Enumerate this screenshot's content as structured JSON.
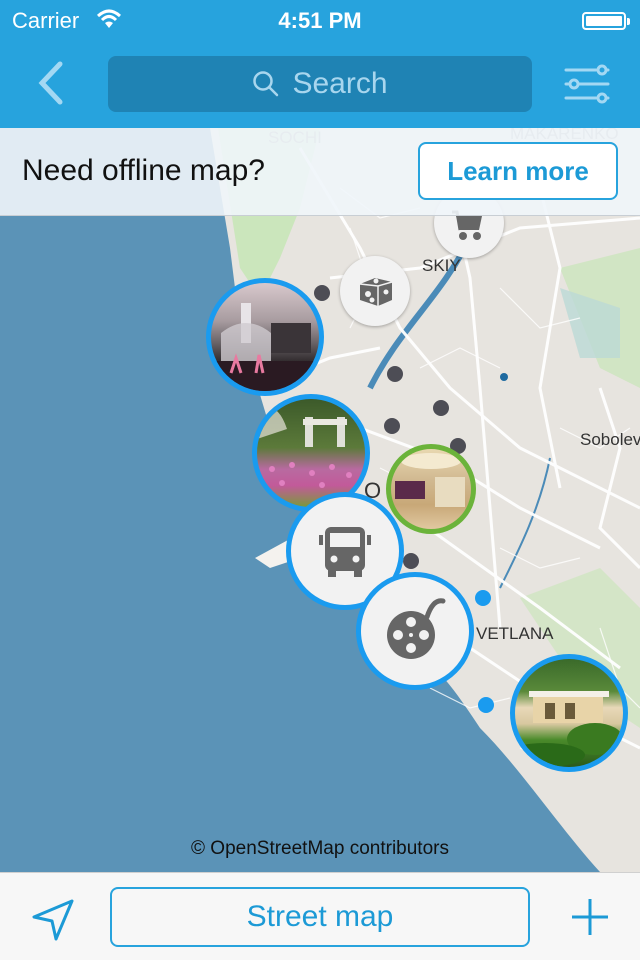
{
  "status_bar": {
    "carrier": "Carrier",
    "time": "4:51 PM",
    "wifi_icon": "wifi-icon",
    "battery_icon": "battery-icon"
  },
  "nav_bar": {
    "back_icon": "chevron-left-icon",
    "search_placeholder": "Search",
    "search_icon": "search-icon",
    "filter_icon": "sliders-icon"
  },
  "banner": {
    "message": "Need offline map?",
    "button_label": "Learn more"
  },
  "map": {
    "labels": [
      "SOCHI",
      "MAKARENKO",
      "SKIY",
      "Sobolev",
      "VETLANA",
      "O"
    ],
    "attribution": "© OpenStreetMap contributors",
    "markers": [
      {
        "type": "icon",
        "icon": "shopping-cart-icon",
        "style": "plain"
      },
      {
        "type": "icon",
        "icon": "cheese-icon",
        "style": "plain"
      },
      {
        "type": "photo",
        "subject": "fountain",
        "ring": "blue"
      },
      {
        "type": "photo",
        "subject": "flower-garden-gate",
        "ring": "blue"
      },
      {
        "type": "photo",
        "subject": "hotel-lobby",
        "ring": "green"
      },
      {
        "type": "icon",
        "icon": "bus-icon",
        "ring": "blue"
      },
      {
        "type": "icon",
        "icon": "film-reel-icon",
        "ring": "blue"
      },
      {
        "type": "photo",
        "subject": "villa-garden",
        "ring": "blue"
      }
    ],
    "colors": {
      "sea": "#5b93b7",
      "land": "#e7e4df",
      "park": "#c8e6b8",
      "ring_blue": "#1a9bef",
      "ring_green": "#6bb33a",
      "dot_gray": "#4d4d55",
      "dot_blue": "#1a9bef"
    }
  },
  "bottom_bar": {
    "locate_icon": "location-arrow-icon",
    "map_type_label": "Street map",
    "add_icon": "plus-icon"
  },
  "theme": {
    "accent": "#27a3dd",
    "search_bg": "#1f83b4"
  }
}
